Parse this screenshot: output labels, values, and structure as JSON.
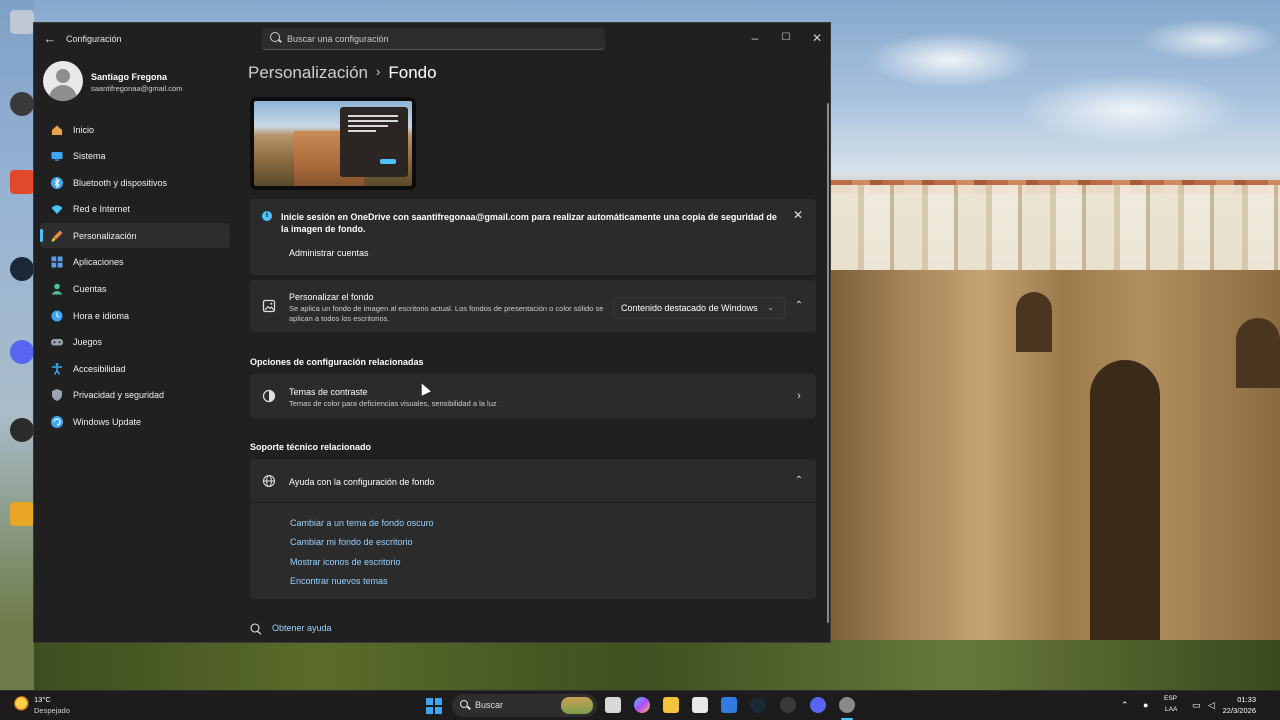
{
  "window": {
    "app_title": "Configuración",
    "search_placeholder": "Buscar una configuración"
  },
  "user": {
    "name": "Santiago Fregona",
    "email": "saantifregonaa@gmail.com"
  },
  "sidebar": {
    "items": [
      {
        "label": "Inicio",
        "icon": "home-icon",
        "color": "#e8a24a"
      },
      {
        "label": "Sistema",
        "icon": "monitor-icon",
        "color": "#3ea7f5"
      },
      {
        "label": "Bluetooth y dispositivos",
        "icon": "bluetooth-icon",
        "color": "#3ea7f5"
      },
      {
        "label": "Red e Internet",
        "icon": "wifi-icon",
        "color": "#4cc2ff"
      },
      {
        "label": "Personalización",
        "icon": "brush-icon",
        "color": "#e68a4a"
      },
      {
        "label": "Aplicaciones",
        "icon": "apps-icon",
        "color": "#5aa0e6"
      },
      {
        "label": "Cuentas",
        "icon": "person-icon",
        "color": "#4fc3a1"
      },
      {
        "label": "Hora e idioma",
        "icon": "globe-clock-icon",
        "color": "#3ea7f5"
      },
      {
        "label": "Juegos",
        "icon": "gamepad-icon",
        "color": "#9aa4b0"
      },
      {
        "label": "Accesibilidad",
        "icon": "accessibility-icon",
        "color": "#3ea7f5"
      },
      {
        "label": "Privacidad y seguridad",
        "icon": "shield-icon",
        "color": "#9aa4b0"
      },
      {
        "label": "Windows Update",
        "icon": "update-icon",
        "color": "#3ea7f5"
      }
    ],
    "active_index": 4
  },
  "breadcrumb": {
    "parent": "Personalización",
    "current": "Fondo"
  },
  "onedrive_banner": {
    "text": "Inicie sesión en OneDrive con saantifregonaa@gmail.com para realizar automáticamente una copia de seguridad de la imagen de fondo.",
    "button": "Administrar cuentas"
  },
  "personalize": {
    "title": "Personalizar el fondo",
    "desc": "Se aplica un fondo de imagen al escritorio actual. Los fondos de presentación o color sólido se aplican a todos los escritorios.",
    "dropdown_value": "Contenido destacado de Windows"
  },
  "related": {
    "heading": "Opciones de configuración relacionadas",
    "contrast_title": "Temas de contraste",
    "contrast_desc": "Temas de color para deficiencias visuales, sensibilidad a la luz"
  },
  "support": {
    "heading": "Soporte técnico relacionado",
    "help_title": "Ayuda con la configuración de fondo",
    "links": [
      "Cambiar a un tema de fondo oscuro",
      "Cambiar mi fondo de escritorio",
      "Mostrar iconos de escritorio",
      "Encontrar nuevos temas"
    ]
  },
  "get_help": "Obtener ayuda",
  "taskbar": {
    "weather_temp": "13°C",
    "weather_desc": "Despejado",
    "search_label": "Buscar",
    "lang_top": "ESP",
    "lang_bottom": "LAA",
    "time": "01:33",
    "date": "22/3/2026"
  }
}
